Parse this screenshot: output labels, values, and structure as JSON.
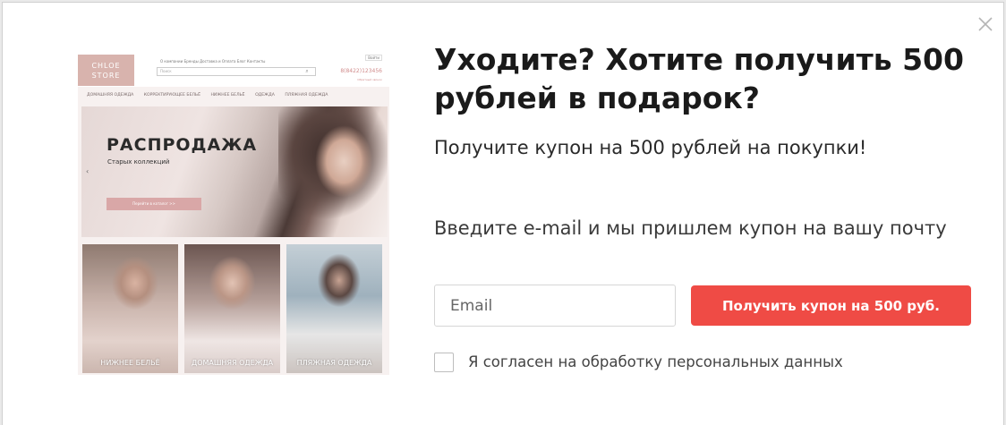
{
  "popup": {
    "title": "Уходите? Хотите получить 500 рублей в подарок?",
    "subtitle": "Получите купон на 500 рублей на покупки!",
    "prompt": "Введите e-mail и мы пришлем купон на вашу почту",
    "email_placeholder": "Email",
    "email_value": "",
    "submit_label": "Получить купон на 500 руб.",
    "consent_label": "Я согласен на обработку персональных данных",
    "consent_checked": false,
    "close_icon": "close-icon",
    "accent_color": "#ef4b45"
  },
  "preview": {
    "logo": "CHLOE STORE",
    "top_nav": "О компании   Бренды   Доставка и Оплата   Блог   Контакты",
    "search_placeholder": "Поиск",
    "phone": "8(8422)123456",
    "account": "Войти",
    "callback": "Обратный звонок",
    "categories": [
      "ДОМАШНЯЯ ОДЕЖДА",
      "КОРРЕКТИРУЮЩЕЕ БЕЛЬЁ",
      "НИЖНЕЕ БЕЛЬЁ",
      "ОДЕЖДА",
      "ПЛЯЖНАЯ ОДЕЖДА"
    ],
    "hero_title": "РАСПРОДАЖА",
    "hero_subtitle": "Старых коллекций",
    "hero_button": "Перейти в каталог  >>",
    "thumbs": [
      "НИЖНЕЕ БЕЛЬЁ",
      "ДОМАШНЯЯ ОДЕЖДА",
      "ПЛЯЖНАЯ ОДЕЖДА"
    ]
  }
}
